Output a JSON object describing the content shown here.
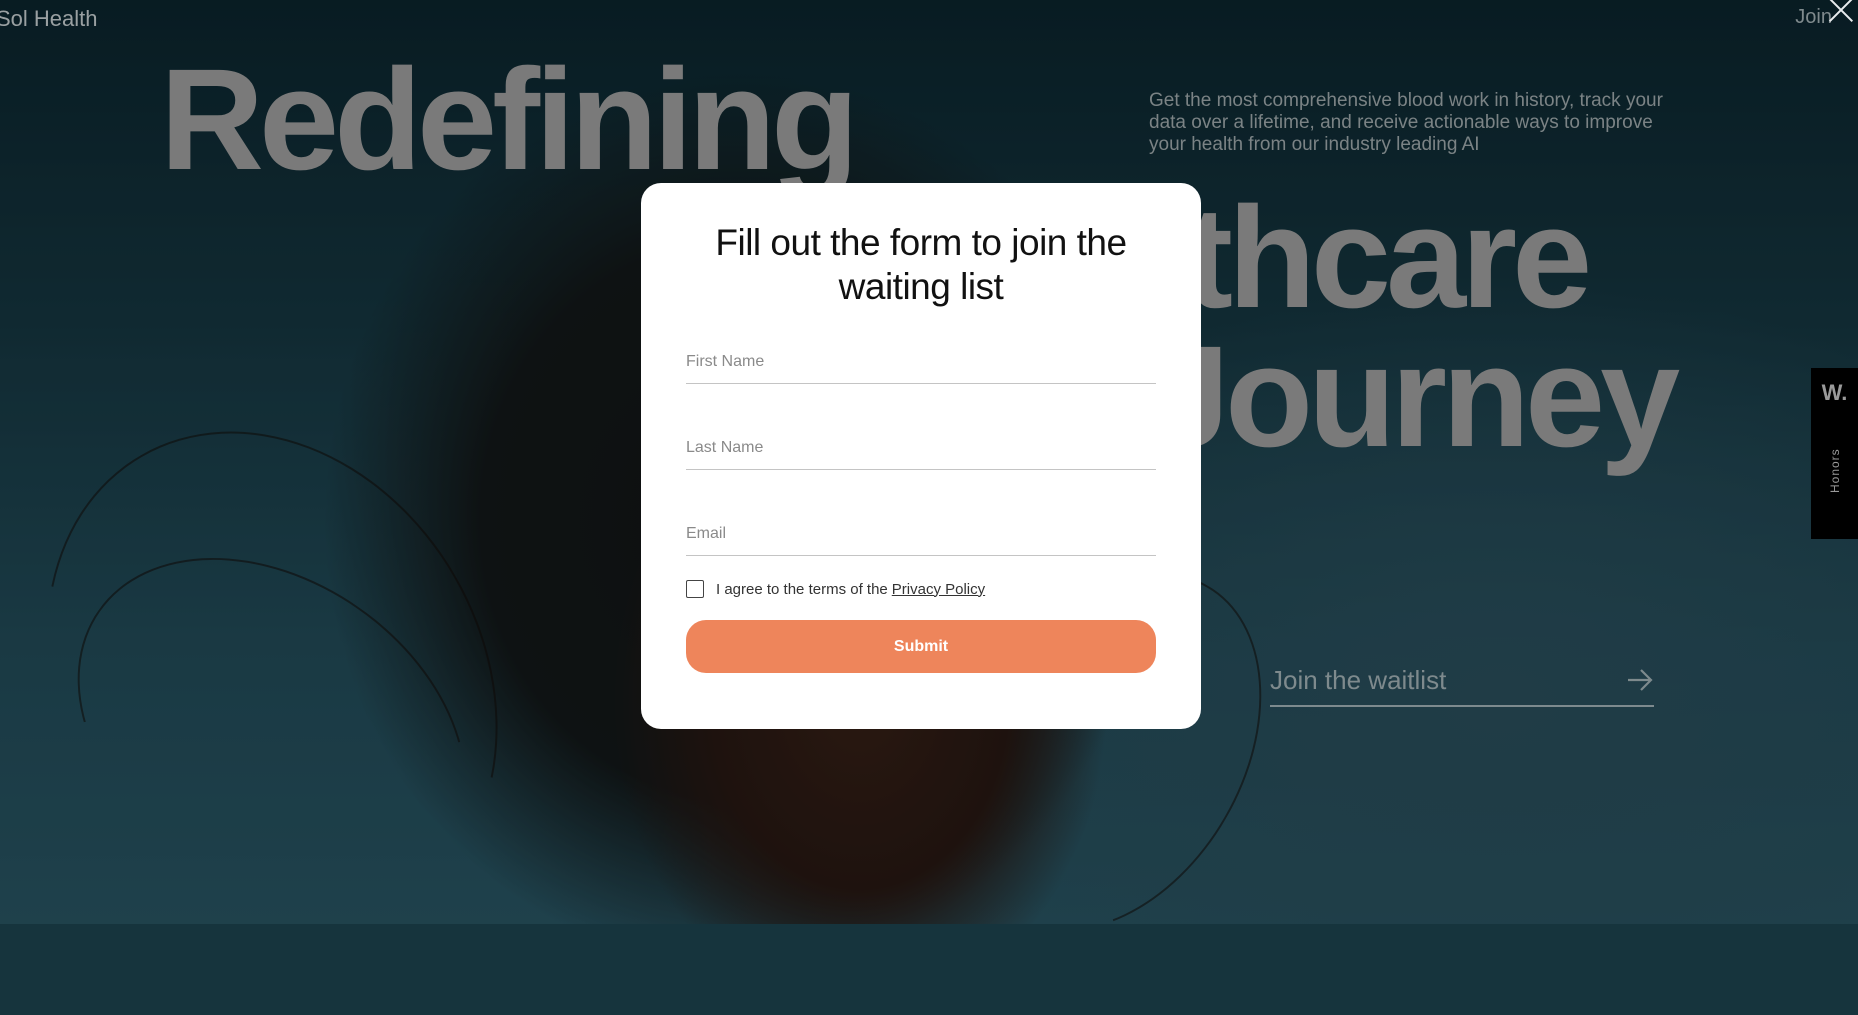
{
  "header": {
    "brand": "Sol Health",
    "join_link": "Join",
    "close_icon": "close-icon"
  },
  "hero": {
    "word_1": "Redefining",
    "word_2": "lthcare",
    "word_3": "Journey",
    "subtitle": "Get the most comprehensive blood work in history, track your data over a lifetime, and receive actionable ways to improve your health from our industry leading AI",
    "waitlist_label": "Join the waitlist",
    "waitlist_icon": "arrow-right-icon"
  },
  "side_badge": {
    "logo": "W.",
    "label": "Honors"
  },
  "modal": {
    "title": "Fill out the form to join the waiting list",
    "first_name_placeholder": "First Name",
    "last_name_placeholder": "Last Name",
    "email_placeholder": "Email",
    "agree_text": "I agree to the terms of the",
    "privacy_link": "Privacy Policy",
    "submit_label": "Submit",
    "accent_color": "#ee855b"
  }
}
